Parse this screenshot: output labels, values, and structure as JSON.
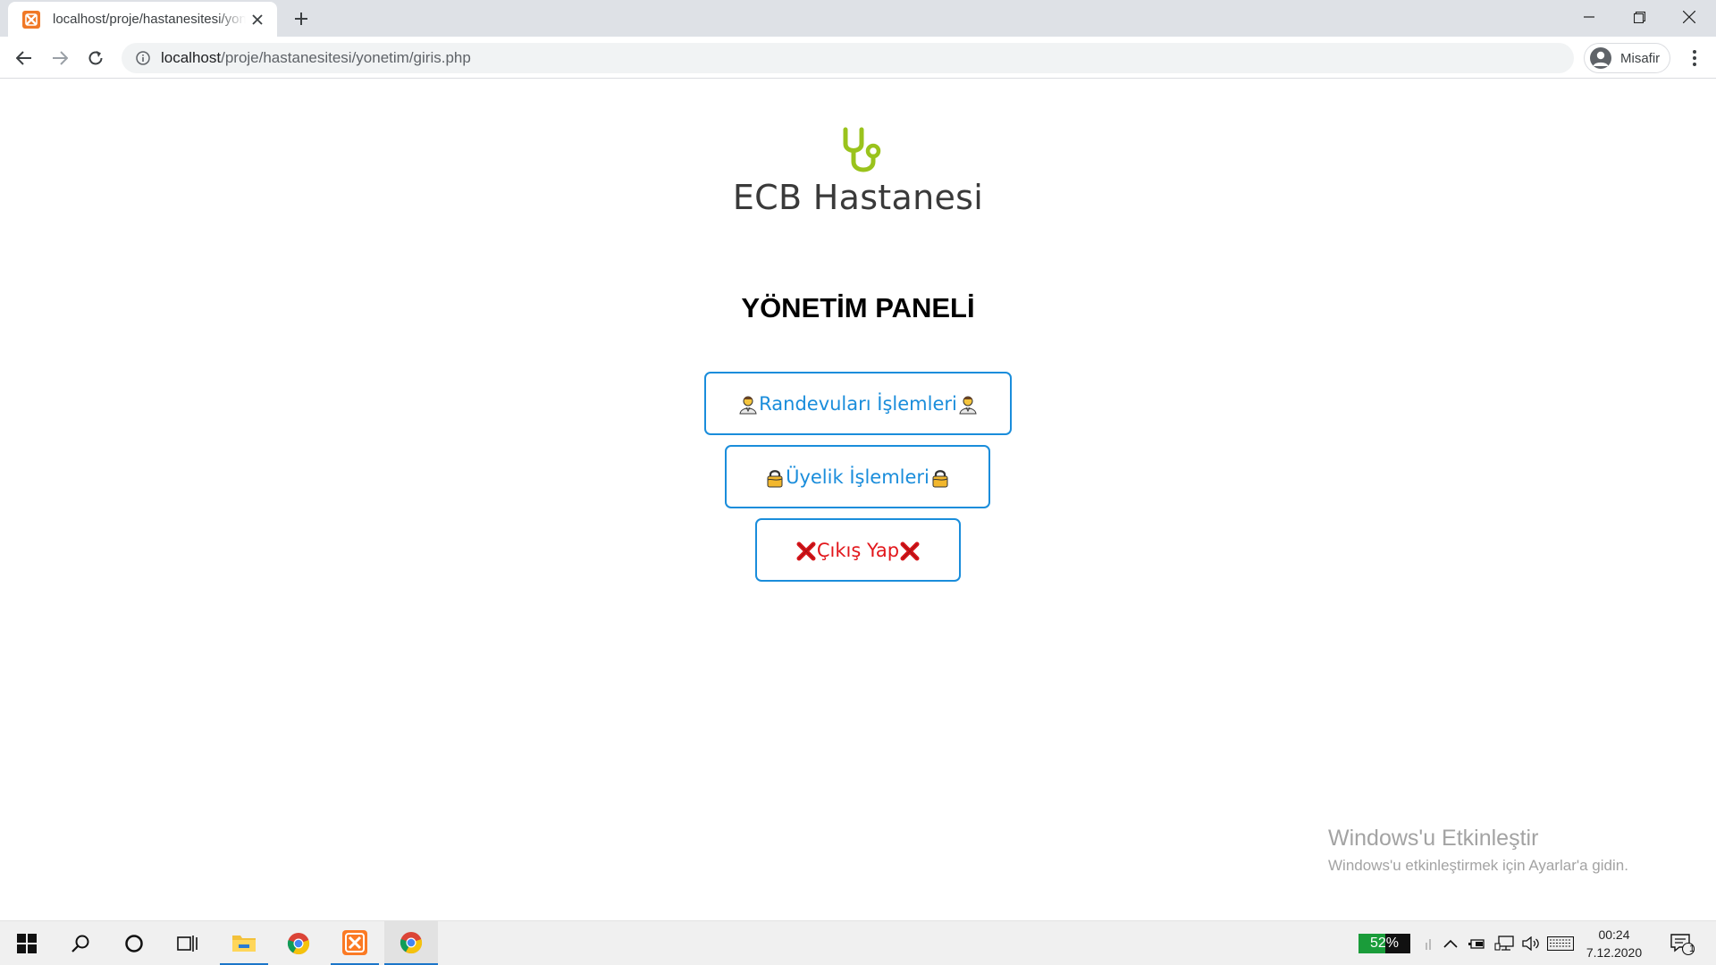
{
  "browser": {
    "tab_title": "localhost/proje/hastanesitesi/yonetim/giris.php",
    "url_host": "localhost",
    "url_path": "/proje/hastanesitesi/yonetim/giris.php",
    "profile_label": "Misafir",
    "icons": [
      "tab-favicon",
      "close-icon",
      "plus-icon",
      "minimize-icon",
      "restore-icon",
      "back-icon",
      "forward-icon",
      "reload-icon",
      "info-icon",
      "profile-icon",
      "more-vert-icon"
    ]
  },
  "page": {
    "logo_text": "ECB Hastanesi",
    "title": "YÖNETİM PANELİ",
    "buttons": [
      {
        "label": "Randevuları İşlemleri",
        "icon": "health-worker-emoji"
      },
      {
        "label": "Üyelik İşlemleri",
        "icon": "lock-emoji"
      },
      {
        "label": "Çıkış Yap",
        "icon": "cross-mark-emoji"
      }
    ],
    "colors": {
      "accent": "#1a8ddb",
      "danger": "#e2161b",
      "logo_green": "#9ac31c"
    }
  },
  "watermark": {
    "title": "Windows'u Etkinleştir",
    "subtitle": "Windows'u etkinleştirmek için Ayarlar'a gidin."
  },
  "taskbar": {
    "battery_label": "52%",
    "battery_level": 0.52,
    "time": "00:24",
    "date": "7.12.2020",
    "notification_count": "1",
    "apps": [
      "start-icon",
      "search-icon",
      "cortana-icon",
      "task-view-icon",
      "file-explorer-icon",
      "chrome-icon",
      "xampp-icon",
      "chrome-icon"
    ]
  }
}
